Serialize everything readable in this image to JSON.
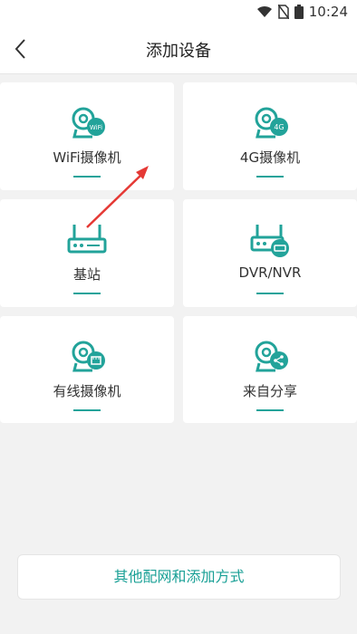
{
  "status": {
    "time": "10:24"
  },
  "header": {
    "title": "添加设备"
  },
  "cards": [
    {
      "label": "WiFi摄像机",
      "icon": "wifi-camera-icon",
      "badge": "WiFi"
    },
    {
      "label": "4G摄像机",
      "icon": "4g-camera-icon",
      "badge": "4G"
    },
    {
      "label": "基站",
      "icon": "base-station-icon"
    },
    {
      "label": "DVR/NVR",
      "icon": "dvr-nvr-icon"
    },
    {
      "label": "有线摄像机",
      "icon": "wired-camera-icon"
    },
    {
      "label": "来自分享",
      "icon": "share-camera-icon"
    }
  ],
  "footer": {
    "button_label": "其他配网和添加方式"
  },
  "colors": {
    "accent": "#22a39a",
    "annotation": "#e53935"
  }
}
